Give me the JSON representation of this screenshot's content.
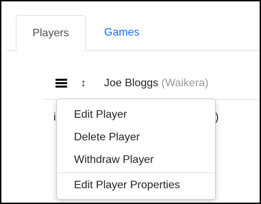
{
  "tabs": [
    {
      "label": "Players",
      "active": true
    },
    {
      "label": "Games",
      "active": false
    }
  ],
  "row": {
    "name": "Joe Bloggs",
    "club": "(Waikera)"
  },
  "icons": {
    "menu": "hamburger-icon",
    "sort": "sort-arrows-icon",
    "sort_glyph": "↕"
  },
  "background_row": {
    "left_char": "i",
    "right_char": ")"
  },
  "context_menu": {
    "items": [
      "Edit Player",
      "Delete Player",
      "Withdraw Player"
    ],
    "after_divider": [
      "Edit Player Properties"
    ]
  },
  "colors": {
    "link": "#0d6efd",
    "muted": "#999999",
    "text": "#212529",
    "border": "#dee2e6"
  }
}
